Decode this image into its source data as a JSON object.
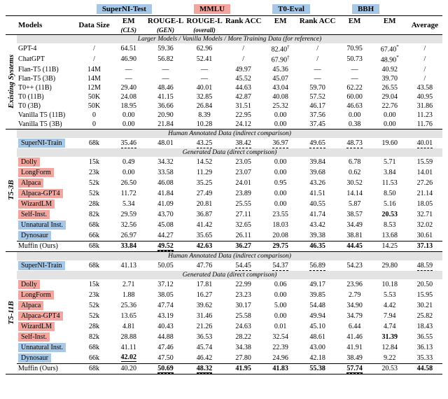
{
  "column_tags": {
    "superni": "SuperNI-Test",
    "mmlu": "MMLU",
    "t0": "T0-Eval",
    "bbh": "BBH"
  },
  "headers": {
    "row1": {
      "models": "Models",
      "data_size": "Data Size",
      "average": "Average"
    },
    "row2": {
      "em_cls": "EM",
      "rouge_gen": "ROUGE-L",
      "rouge_all": "ROUGE-L",
      "rank_acc1": "Rank ACC",
      "em1": "EM",
      "rank_acc2": "Rank ACC",
      "em2": "EM",
      "em3": "EM"
    },
    "row3": {
      "em_cls": "(CLS)",
      "rouge_gen": "(GEN)",
      "rouge_all": "(overall)"
    }
  },
  "sections": {
    "ref": "Larger Models / Vanilla Models / More Training Data (for reference)",
    "human": "Human Annotated Data (indirect comparison)",
    "gen": "Generated Data (direct comprison)"
  },
  "group_labels": {
    "existing": "Existing Systems",
    "t53b": "T5-3B",
    "t511b": "T5-11B"
  },
  "chart_data": {
    "type": "table",
    "column_groups": [
      "SuperNI-Test",
      "SuperNI-Test",
      "SuperNI-Test",
      "MMLU",
      "MMLU",
      "T0-Eval",
      "T0-Eval",
      "BBH",
      ""
    ],
    "columns": [
      "Models",
      "Data Size",
      "EM (CLS)",
      "ROUGE-L (GEN)",
      "ROUGE-L (overall)",
      "Rank ACC",
      "EM",
      "Rank ACC",
      "EM",
      "EM",
      "Average"
    ],
    "groups": [
      {
        "label": "Existing Systems",
        "sections": [
          {
            "title": "Larger Models / Vanilla Models / More Training Data (for reference)",
            "rows": [
              {
                "model": "GPT-4",
                "size": "/",
                "cells": [
                  "64.51",
                  "59.36",
                  "62.96",
                  "/",
                  "82.40†",
                  "/",
                  "70.95",
                  "67.40*",
                  "/"
                ]
              },
              {
                "model": "ChatGPT",
                "size": "/",
                "cells": [
                  "46.90",
                  "56.82",
                  "52.41",
                  "/",
                  "67.90†",
                  "/",
                  "50.73",
                  "48.90*",
                  "/"
                ]
              },
              {
                "model": "Flan-T5 (11B)",
                "size": "14M",
                "cells": [
                  "—",
                  "—",
                  "—",
                  "49.97",
                  "45.36",
                  "—",
                  "—",
                  "40.92",
                  "/"
                ]
              },
              {
                "model": "Flan-T5 (3B)",
                "size": "14M",
                "cells": [
                  "—",
                  "—",
                  "—",
                  "45.52",
                  "45.07",
                  "—",
                  "—",
                  "39.70",
                  "/"
                ]
              },
              {
                "model": "T0++ (11B)",
                "size": "12M",
                "cells": [
                  "29.40",
                  "48.46",
                  "40.01",
                  "44.63",
                  "43.04",
                  "59.70",
                  "62.22",
                  "26.55",
                  "43.58"
                ]
              },
              {
                "model": "T0 (11B)",
                "size": "50K",
                "cells": [
                  "24.08",
                  "41.15",
                  "32.85",
                  "42.87",
                  "40.08",
                  "57.52",
                  "60.00",
                  "29.04",
                  "40.95"
                ]
              },
              {
                "model": "T0 (3B)",
                "size": "50K",
                "cells": [
                  "18.95",
                  "36.66",
                  "26.84",
                  "31.51",
                  "25.32",
                  "46.17",
                  "46.63",
                  "22.76",
                  "31.86"
                ]
              },
              {
                "model": "Vanilla T5 (11B)",
                "size": "0",
                "cells": [
                  "0.00",
                  "20.90",
                  "8.39",
                  "22.95",
                  "0.00",
                  "37.56",
                  "0.00",
                  "0.00",
                  "11.23"
                ]
              },
              {
                "model": "Vanilla T5 (3B)",
                "size": "0",
                "cells": [
                  "0.00",
                  "21.84",
                  "10.28",
                  "24.12",
                  "0.00",
                  "37.45",
                  "0.38",
                  "0.00",
                  "11.76"
                ]
              }
            ]
          }
        ]
      },
      {
        "label": "T5-3B",
        "sections": [
          {
            "title": "Human Annotated Data (indirect comparison)",
            "rows": [
              {
                "model": "SuperNI-Train",
                "pill": "blue",
                "size": "68k",
                "cells": [
                  "35.46",
                  "48.01",
                  "43.25",
                  "38.42",
                  "36.97",
                  "49.65",
                  "48.73",
                  "19.60",
                  "40.01"
                ],
                "underline2": [
                  0,
                  2,
                  3,
                  4,
                  5,
                  6,
                  8
                ]
              }
            ]
          },
          {
            "title": "Generated Data (direct comprison)",
            "rows": [
              {
                "model": "Dolly",
                "pill": "red",
                "size": "15k",
                "cells": [
                  "0.49",
                  "34.32",
                  "14.52",
                  "23.05",
                  "0.00",
                  "39.84",
                  "6.78",
                  "5.71",
                  "15.59"
                ]
              },
              {
                "model": "LongForm",
                "pill": "red",
                "size": "23k",
                "cells": [
                  "0.00",
                  "33.58",
                  "11.29",
                  "23.07",
                  "0.00",
                  "39.68",
                  "0.62",
                  "3.84",
                  "14.01"
                ]
              },
              {
                "model": "Alpaca",
                "pill": "red",
                "size": "52k",
                "cells": [
                  "26.50",
                  "46.08",
                  "35.25",
                  "24.01",
                  "0.95",
                  "43.26",
                  "30.52",
                  "11.53",
                  "27.26"
                ]
              },
              {
                "model": "Alpaca-GPT4",
                "pill": "red",
                "size": "52k",
                "cells": [
                  "11.72",
                  "41.84",
                  "27.49",
                  "23.89",
                  "0.00",
                  "41.51",
                  "14.14",
                  "8.50",
                  "21.14"
                ]
              },
              {
                "model": "WizardLM",
                "pill": "red",
                "size": "28k",
                "cells": [
                  "5.34",
                  "41.09",
                  "20.81",
                  "25.55",
                  "0.00",
                  "40.55",
                  "5.87",
                  "5.16",
                  "18.05"
                ]
              },
              {
                "model": "Self-Inst.",
                "pill": "red",
                "size": "82k",
                "cells": [
                  "29.59",
                  "43.70",
                  "36.87",
                  "27.11",
                  "23.55",
                  "41.74",
                  "38.57",
                  "20.53",
                  "32.71"
                ],
                "bold": [
                  7
                ]
              },
              {
                "model": "Unnatural Inst.",
                "pill": "blue",
                "size": "68k",
                "cells": [
                  "32.56",
                  "45.08",
                  "41.42",
                  "32.65",
                  "18.03",
                  "43.42",
                  "34.49",
                  "8.53",
                  "32.02"
                ]
              },
              {
                "model": "Dynosaur",
                "pill": "blue",
                "size": "66k",
                "cells": [
                  "26.97",
                  "44.27",
                  "35.65",
                  "26.11",
                  "20.08",
                  "39.38",
                  "38.81",
                  "13.68",
                  "30.61"
                ]
              }
            ]
          },
          {
            "final": true,
            "rows": [
              {
                "model": "Muffin (Ours)",
                "size": "68k",
                "cells": [
                  "33.84",
                  "49.52",
                  "42.63",
                  "36.27",
                  "29.75",
                  "46.35",
                  "44.45",
                  "14.25",
                  "37.13"
                ],
                "bold": [
                  0,
                  1,
                  2,
                  3,
                  4,
                  5,
                  6,
                  8
                ],
                "underline1": [
                  1
                ],
                "underline2": [
                  1
                ]
              }
            ]
          }
        ]
      },
      {
        "label": "T5-11B",
        "sections": [
          {
            "title": "Human Annotated Data (indirect comparison)",
            "rows": [
              {
                "model": "SuperNI-Train",
                "pill": "blue",
                "size": "68k",
                "cells": [
                  "41.13",
                  "50.05",
                  "47.76",
                  "54.45",
                  "54.37",
                  "56.89",
                  "54.23",
                  "29.80",
                  "48.59"
                ],
                "underline2": [
                  3,
                  4,
                  5,
                  8
                ]
              }
            ]
          },
          {
            "title": "Generated Data (direct comprison)",
            "rows": [
              {
                "model": "Dolly",
                "pill": "red",
                "size": "15k",
                "cells": [
                  "2.71",
                  "37.12",
                  "17.81",
                  "22.99",
                  "0.06",
                  "49.17",
                  "23.96",
                  "10.18",
                  "20.50"
                ]
              },
              {
                "model": "LongForm",
                "pill": "red",
                "size": "23k",
                "cells": [
                  "1.88",
                  "38.05",
                  "16.27",
                  "23.23",
                  "0.00",
                  "39.85",
                  "2.79",
                  "5.53",
                  "15.95"
                ]
              },
              {
                "model": "Alpaca",
                "pill": "red",
                "size": "52k",
                "cells": [
                  "25.36",
                  "47.74",
                  "39.62",
                  "30.17",
                  "5.00",
                  "54.48",
                  "34.90",
                  "4.42",
                  "30.21"
                ]
              },
              {
                "model": "Alpaca-GPT4",
                "pill": "red",
                "size": "52k",
                "cells": [
                  "13.65",
                  "43.19",
                  "31.46",
                  "25.58",
                  "0.00",
                  "49.94",
                  "34.79",
                  "7.94",
                  "25.82"
                ]
              },
              {
                "model": "WizardLM",
                "pill": "red",
                "size": "28k",
                "cells": [
                  "4.81",
                  "40.43",
                  "21.26",
                  "24.63",
                  "0.01",
                  "45.10",
                  "6.44",
                  "4.74",
                  "18.43"
                ]
              },
              {
                "model": "Self-Inst.",
                "pill": "red",
                "size": "82k",
                "cells": [
                  "28.88",
                  "44.88",
                  "36.53",
                  "28.22",
                  "32.54",
                  "48.61",
                  "41.46",
                  "31.39",
                  "36.55"
                ],
                "bold": [
                  7
                ]
              },
              {
                "model": "Unnatural Inst.",
                "pill": "blue",
                "size": "68k",
                "cells": [
                  "41.11",
                  "47.46",
                  "45.74",
                  "34.38",
                  "22.39",
                  "43.00",
                  "41.91",
                  "12.84",
                  "36.13"
                ]
              },
              {
                "model": "Dynosaur",
                "pill": "blue",
                "size": "66k",
                "cells": [
                  "42.02",
                  "47.50",
                  "46.42",
                  "27.80",
                  "24.96",
                  "42.18",
                  "38.49",
                  "9.22",
                  "35.33"
                ],
                "bold": [
                  0
                ],
                "underline1": [
                  0
                ]
              }
            ]
          },
          {
            "final": true,
            "rows": [
              {
                "model": "Muffin (Ours)",
                "size": "68k",
                "cells": [
                  "40.20",
                  "50.69",
                  "48.32",
                  "41.95",
                  "41.83",
                  "55.38",
                  "57.74",
                  "20.53",
                  "44.58"
                ],
                "bold": [
                  1,
                  2,
                  3,
                  4,
                  5,
                  6,
                  8
                ],
                "underline2": [
                  1,
                  2,
                  6
                ],
                "underline1": [
                  1,
                  2,
                  6
                ]
              }
            ]
          }
        ]
      }
    ]
  }
}
